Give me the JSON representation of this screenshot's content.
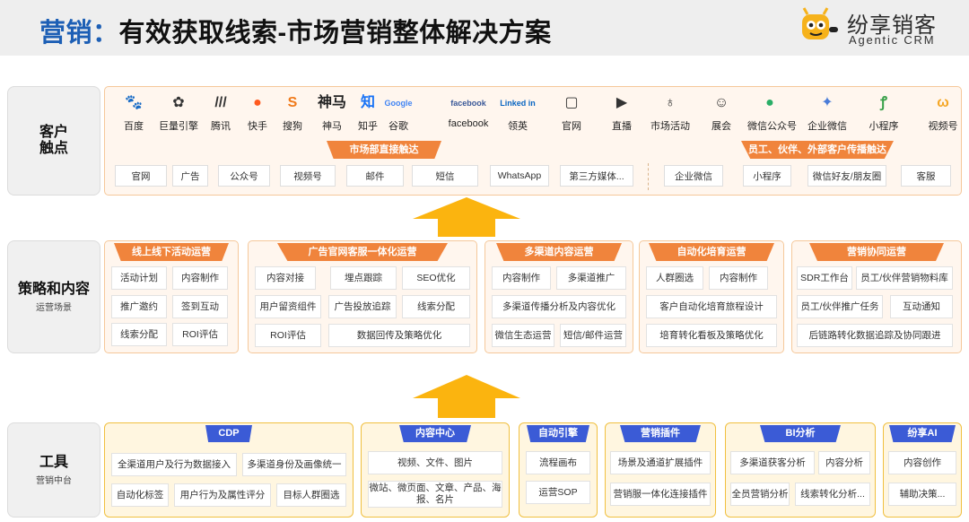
{
  "title": {
    "prefix": "营销：",
    "rest": "有效获取线索-市场营销整体解决方案"
  },
  "logo": {
    "name": "纷享销客",
    "sub": "Agentic CRM"
  },
  "rows": {
    "touch": {
      "main1": "客户",
      "main2": "触点"
    },
    "strategy": {
      "main": "策略和内容",
      "sub": "运营场景"
    },
    "tools": {
      "main": "工具",
      "sub": "营销中台"
    }
  },
  "channels": [
    {
      "label": "百度",
      "icon": "baidu-icon",
      "glyph": "🐾",
      "color": "#2b2b2b"
    },
    {
      "label": "巨量引擎",
      "icon": "ocean-engine-icon",
      "glyph": "✿",
      "color": "#333333"
    },
    {
      "label": "腾讯",
      "icon": "tencent-icon",
      "glyph": "///",
      "color": "#333333"
    },
    {
      "label": "快手",
      "icon": "kuaishou-icon",
      "glyph": "●",
      "color": "#ff5a1f"
    },
    {
      "label": "搜狗",
      "icon": "sogou-icon",
      "glyph": "S",
      "color": "#f07a1a"
    },
    {
      "label": "神马",
      "icon": "shenma-icon",
      "glyph": "神马",
      "color": "#222222"
    },
    {
      "label": "知乎",
      "icon": "zhihu-icon",
      "glyph": "知",
      "color": "#1772f6"
    },
    {
      "label": "谷歌",
      "icon": "google-icon",
      "glyph": "Google",
      "color": "#4285f4"
    },
    {
      "label": "facebook",
      "icon": "facebook-icon",
      "glyph": "facebook",
      "color": "#3b5998"
    },
    {
      "label": "领英",
      "icon": "linkedin-icon",
      "glyph": "Linked in",
      "color": "#0a66c2"
    },
    {
      "label": "官网",
      "icon": "website-icon",
      "glyph": "▢",
      "color": "#333333"
    },
    {
      "label": "直播",
      "icon": "live-icon",
      "glyph": "▶",
      "color": "#333333"
    },
    {
      "label": "市场活动",
      "icon": "marketing-event-icon",
      "glyph": "♁",
      "color": "#333333"
    },
    {
      "label": "展会",
      "icon": "exhibition-icon",
      "glyph": "☺",
      "color": "#333333"
    },
    {
      "label": "微信公众号",
      "icon": "wechat-official-icon",
      "glyph": "●",
      "color": "#2aae67"
    },
    {
      "label": "企业微信",
      "icon": "wecom-icon",
      "glyph": "✦",
      "color": "#4a7cd8"
    },
    {
      "label": "小程序",
      "icon": "mini-program-icon",
      "glyph": "ꝭ",
      "color": "#3aa14a"
    },
    {
      "label": "视频号",
      "icon": "channels-icon",
      "glyph": "ω",
      "color": "#f5a623"
    }
  ],
  "touch_banners": {
    "direct": "市场部直接触达",
    "spread": "员工、伙伴、外部客户传播触达"
  },
  "direct_chips": [
    "官网",
    "广告",
    "公众号",
    "视频号",
    "邮件",
    "短信",
    "WhatsApp",
    "第三方媒体..."
  ],
  "spread_chips": [
    "企业微信",
    "小程序",
    "微信好友/朋友圈",
    "客服"
  ],
  "strategy_groups": [
    {
      "title": "线上线下活动运营",
      "items": [
        "活动计划",
        "内容制作",
        "推广邀约",
        "签到互动",
        "线索分配",
        "ROI评估"
      ]
    },
    {
      "title": "广告官网客服一体化运营",
      "items": [
        "内容对接",
        "埋点跟踪",
        "SEO优化",
        "用户留资组件",
        "广告投放追踪",
        "线索分配",
        "ROI评估",
        "数据回传及策略优化"
      ]
    },
    {
      "title": "多渠道内容运营",
      "items": [
        "内容制作",
        "多渠道推广",
        "多渠道传播分析及内容优化",
        "微信生态运营",
        "短信/邮件运营"
      ]
    },
    {
      "title": "自动化培育运营",
      "items": [
        "人群圈选",
        "内容制作",
        "客户自动化培育旅程设计",
        "培育转化看板及策略优化"
      ]
    },
    {
      "title": "营销协同运营",
      "items": [
        "SDR工作台",
        "员工/伙伴营销物料库",
        "员工/伙伴推广任务",
        "互动通知",
        "后链路转化数据追踪及协同跟进"
      ]
    }
  ],
  "tool_groups": [
    {
      "title": "CDP",
      "items": [
        "全渠道用户及行为数据接入",
        "多渠道身份及画像统一",
        "自动化标签",
        "用户行为及属性评分",
        "目标人群圈选"
      ]
    },
    {
      "title": "内容中心",
      "items": [
        "视频、文件、图片",
        "微站、微页面、文章、产品、海报、名片"
      ]
    },
    {
      "title": "自动引擎",
      "items": [
        "流程画布",
        "运营SOP"
      ]
    },
    {
      "title": "营销插件",
      "items": [
        "场景及通道扩展插件",
        "营销服一体化连接插件"
      ]
    },
    {
      "title": "BI分析",
      "items": [
        "多渠道获客分析",
        "内容分析",
        "全员营销分析",
        "线索转化分析..."
      ]
    },
    {
      "title": "纷享AI",
      "items": [
        "内容创作",
        "辅助决策..."
      ]
    }
  ],
  "colors": {
    "orange": "#f0843c",
    "blue": "#3b5bd6",
    "arrow": "#fbb40f",
    "title_blue": "#1d5fb5"
  }
}
